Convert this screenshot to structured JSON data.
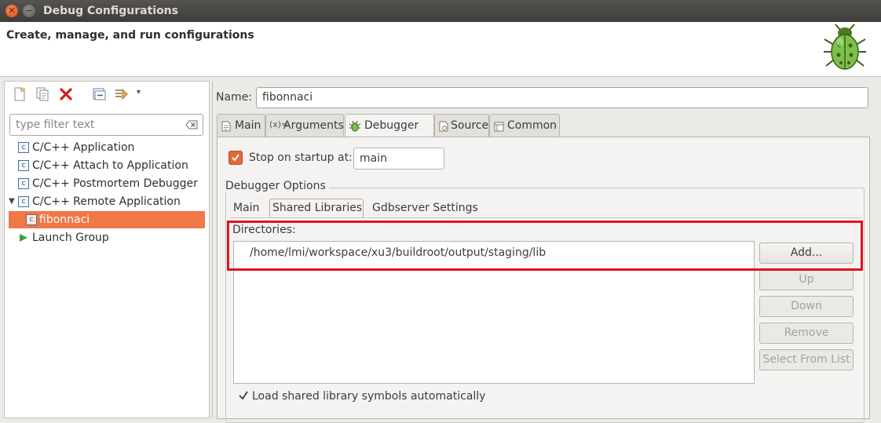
{
  "window": {
    "title": "Debug Configurations"
  },
  "banner": {
    "text": "Create, manage, and run configurations"
  },
  "filter": {
    "placeholder": "type filter text"
  },
  "tree": {
    "items": [
      {
        "label": "C/C++ Application"
      },
      {
        "label": "C/C++ Attach to Application"
      },
      {
        "label": "C/C++ Postmortem Debugger"
      },
      {
        "label": "C/C++ Remote Application"
      },
      {
        "label": "fibonnaci"
      },
      {
        "label": "Launch Group"
      }
    ]
  },
  "config": {
    "name_label": "Name:",
    "name_value": "fibonnaci",
    "tabs": [
      {
        "label": "Main"
      },
      {
        "label": "Arguments"
      },
      {
        "label": "Debugger"
      },
      {
        "label": "Source"
      },
      {
        "label": "Common"
      }
    ],
    "active_tab": "Debugger"
  },
  "debugger": {
    "stop_on_startup_label": "Stop on startup at:",
    "stop_on_startup_checked": true,
    "stop_on_startup_value": "main",
    "options_label": "Debugger Options",
    "subtabs": [
      {
        "label": "Main"
      },
      {
        "label": "Shared Libraries"
      },
      {
        "label": "Gdbserver Settings"
      }
    ],
    "active_subtab": "Shared Libraries",
    "directories_label": "Directories:",
    "directories": [
      "/home/lmi/workspace/xu3/buildroot/output/staging/lib"
    ],
    "buttons": {
      "add": "Add...",
      "up": "Up",
      "down": "Down",
      "remove": "Remove",
      "select_from_list": "Select From List"
    },
    "autoload_label": "Load shared library symbols automatically",
    "autoload_checked": true
  },
  "colors": {
    "accent": "#f07746",
    "highlight": "#e0141e",
    "checkbox": "#e06a36"
  },
  "icons": [
    "new-config-icon",
    "duplicate-icon",
    "delete-icon",
    "collapse-all-icon",
    "filter-icon",
    "bug-icon"
  ]
}
